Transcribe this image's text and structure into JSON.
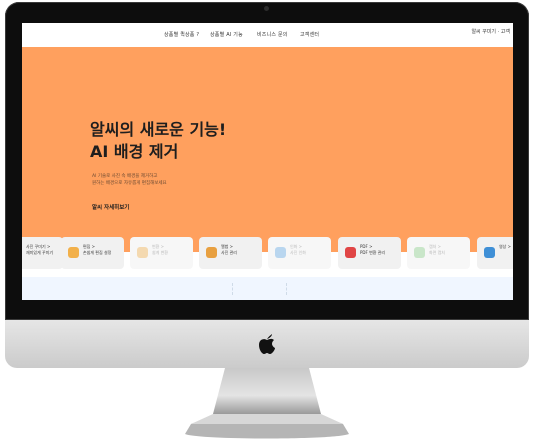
{
  "nav": {
    "items": [
      "상품별 퀵상품 ?",
      "상품별 AI 기능",
      "비즈니스 문의",
      "고객센터"
    ],
    "brand": "알씨 꾸미기 · 고객"
  },
  "hero": {
    "title_line1": "알씨의 새로운 기능!",
    "title_line2": "AI 배경 제거",
    "desc_line1": "AI 기술로 사진 속 배경을 제거하고",
    "desc_line2": "원하는 배경으로 자유롭게 편집해보세요",
    "link": "알씨 자세히보기"
  },
  "cards": [
    {
      "label1": "사진 꾸미기 >",
      "label2": "재미있게 꾸미기",
      "light": false,
      "color": "#7a5b3a"
    },
    {
      "label1": "편집 >",
      "label2": "손쉽게 편집 설정",
      "light": false,
      "color": "#f2b04a"
    },
    {
      "label1": "변환 >",
      "label2": "쉽게 변환",
      "light": true,
      "color": "#f4d9b0"
    },
    {
      "label1": "앨범 >",
      "label2": "사진 관리",
      "light": false,
      "color": "#e8a040"
    },
    {
      "label1": "인화 >",
      "label2": "사진 인화",
      "light": true,
      "color": "#b9d6ef"
    },
    {
      "label1": "PDF >",
      "label2": "PDF 변환 관리",
      "light": false,
      "color": "#e04545"
    },
    {
      "label1": "캡처 >",
      "label2": "화면 캡처",
      "light": true,
      "color": "#c9e6c9"
    },
    {
      "label1": "영상 >",
      "label2": "",
      "light": false,
      "color": "#3f8fd6"
    }
  ]
}
